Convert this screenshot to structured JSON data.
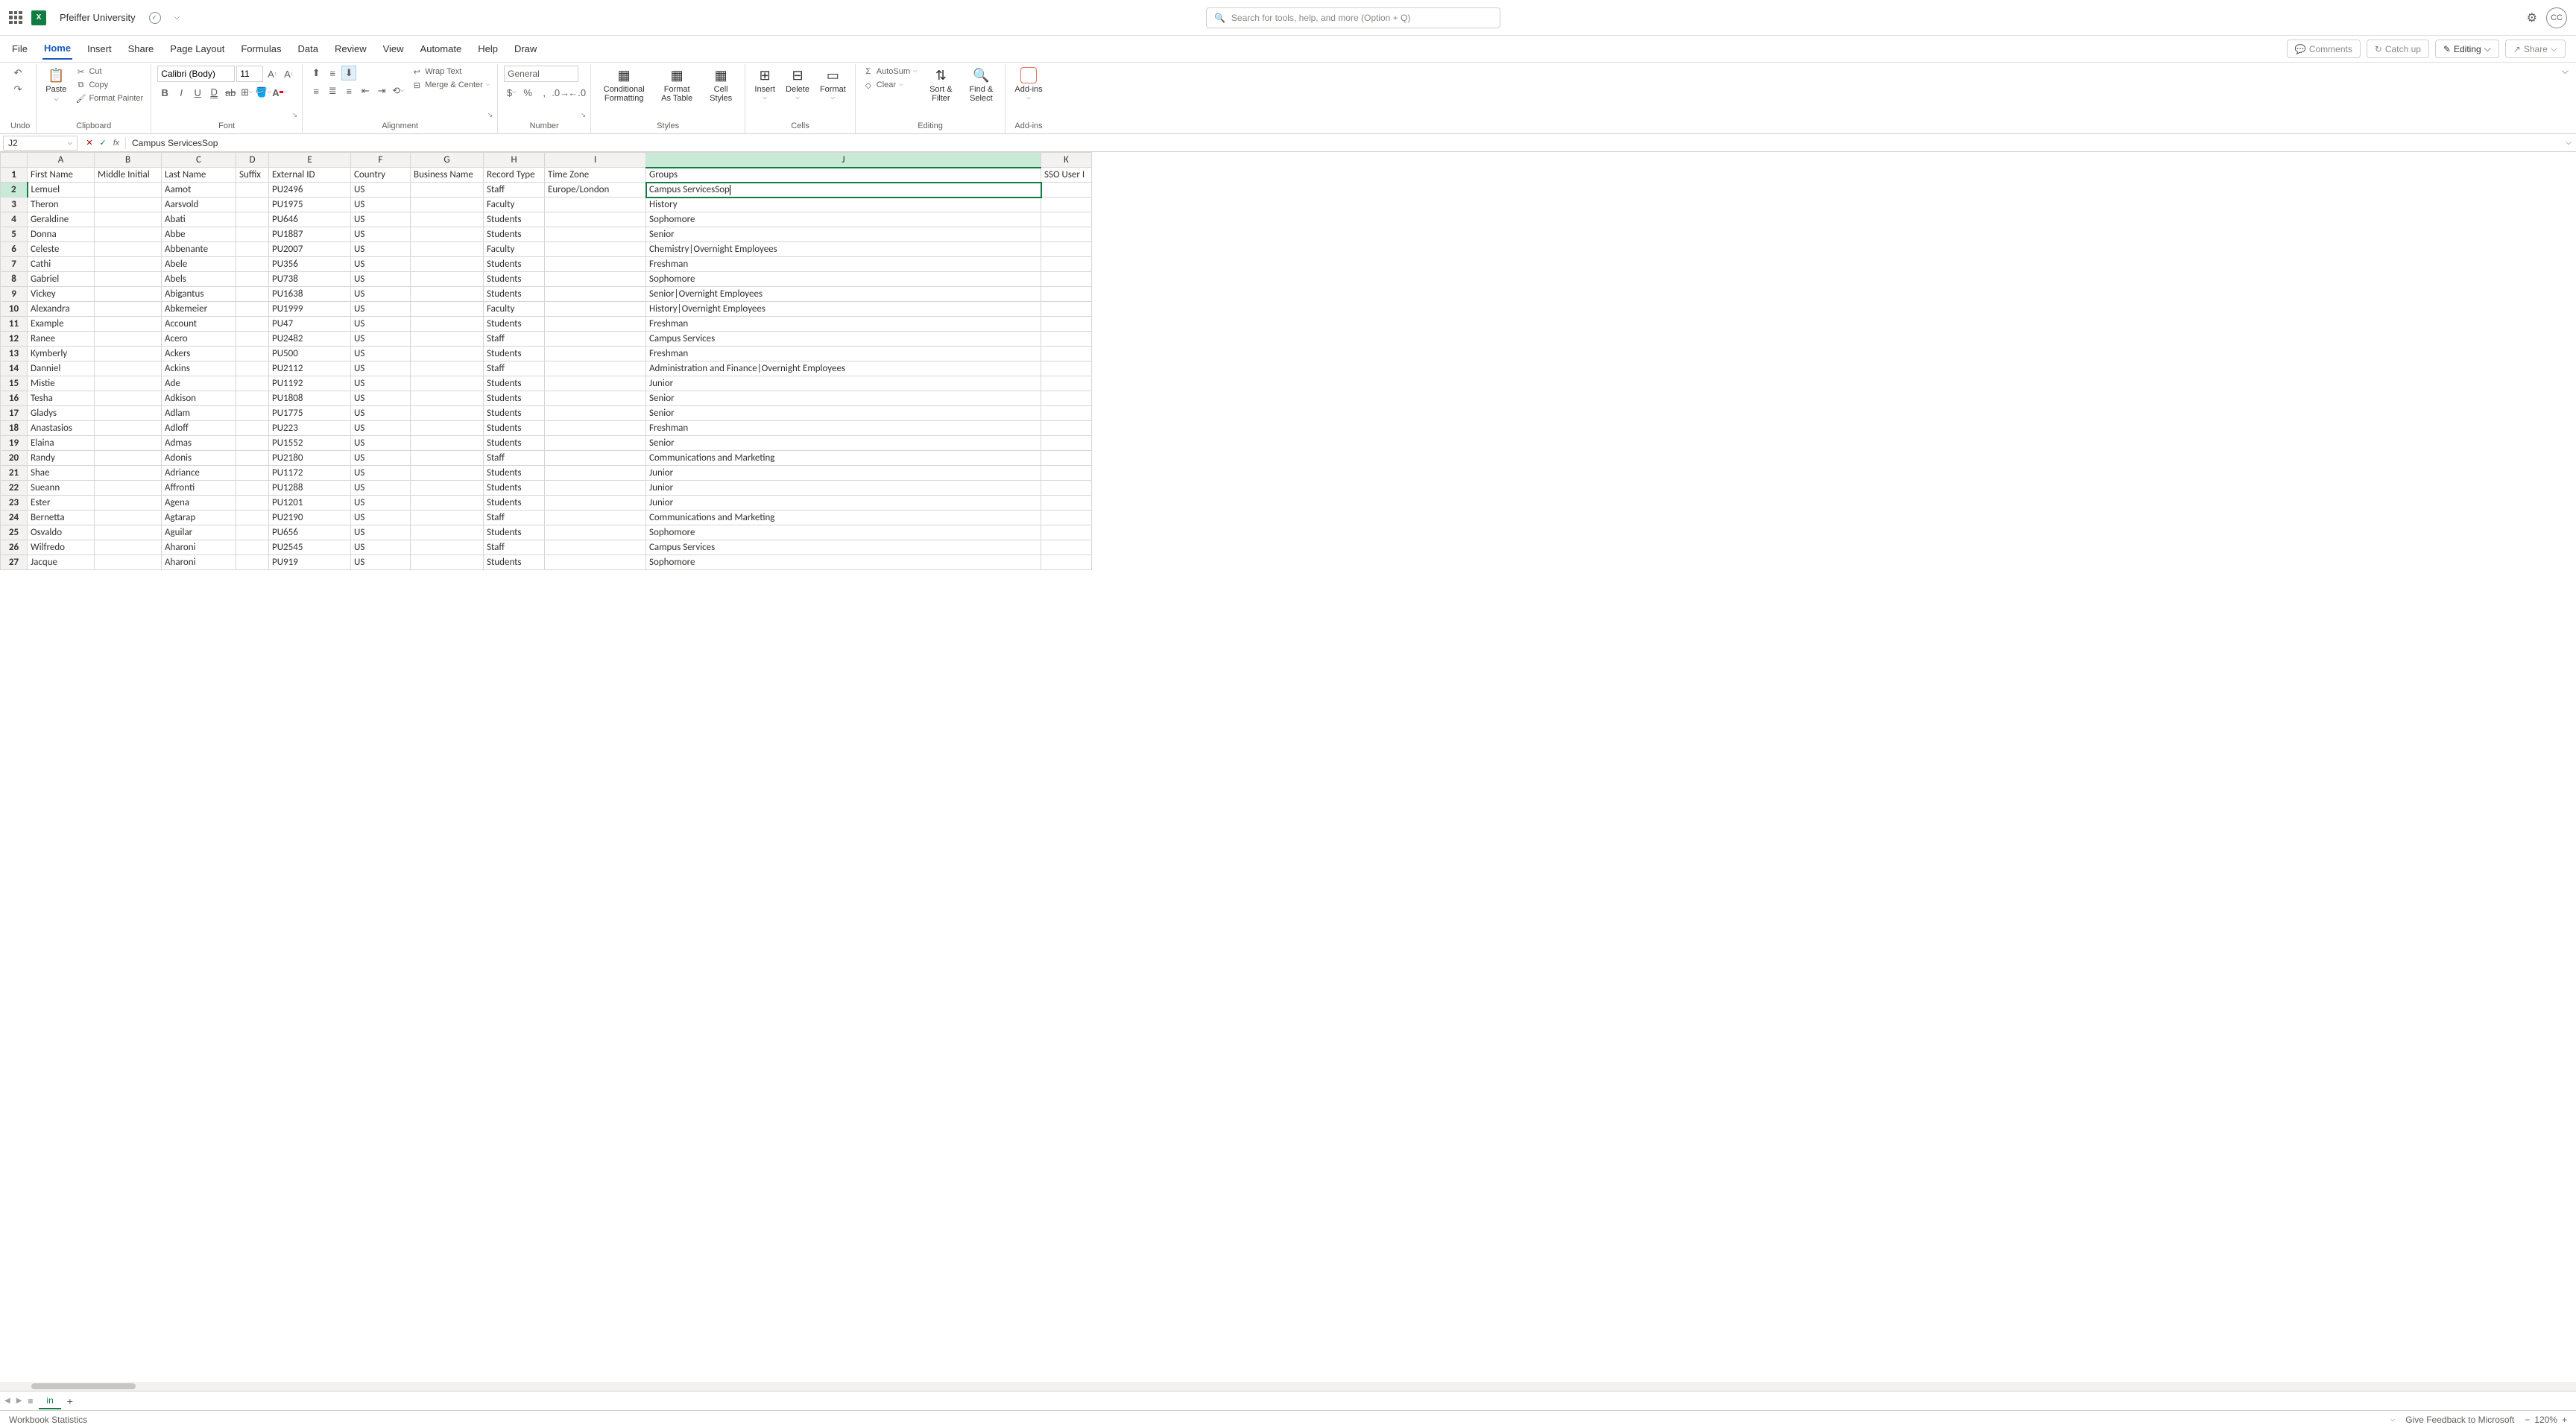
{
  "title": {
    "doc_name": "Pfeiffer University"
  },
  "search": {
    "placeholder": "Search for tools, help, and more (Option + Q)"
  },
  "avatar": "CC",
  "tabs": {
    "items": [
      "File",
      "Home",
      "Insert",
      "Share",
      "Page Layout",
      "Formulas",
      "Data",
      "Review",
      "View",
      "Automate",
      "Help",
      "Draw"
    ],
    "active": "Home",
    "right": {
      "comments": "Comments",
      "catchup": "Catch up",
      "editing": "Editing",
      "share": "Share"
    }
  },
  "ribbon": {
    "undo": "Undo",
    "clipboard": {
      "paste": "Paste",
      "cut": "Cut",
      "copy": "Copy",
      "painter": "Format Painter",
      "label": "Clipboard"
    },
    "font": {
      "name": "Calibri (Body)",
      "size": "11",
      "label": "Font"
    },
    "alignment": {
      "wrap": "Wrap Text",
      "merge": "Merge & Center",
      "label": "Alignment"
    },
    "number": {
      "format": "General",
      "label": "Number"
    },
    "styles": {
      "cond": "Conditional Formatting",
      "table": "Format As Table",
      "cell": "Cell Styles",
      "label": "Styles"
    },
    "cells": {
      "insert": "Insert",
      "delete": "Delete",
      "format": "Format",
      "label": "Cells"
    },
    "editing": {
      "autosum": "AutoSum",
      "clear": "Clear",
      "sort": "Sort & Filter",
      "find": "Find & Select",
      "label": "Editing"
    },
    "addins": {
      "label": "Add-ins",
      "btn": "Add-ins"
    }
  },
  "formula_bar": {
    "cell_ref": "J2",
    "formula": "Campus ServicesSop"
  },
  "columns": [
    "A",
    "B",
    "C",
    "D",
    "E",
    "F",
    "G",
    "H",
    "I",
    "J",
    "K"
  ],
  "headers": [
    "First Name",
    "Middle Initial",
    "Last Name",
    "Suffix",
    "External ID",
    "Country",
    "Business Name",
    "Record Type",
    "Time Zone",
    "Groups",
    "SSO User I"
  ],
  "active_cell": {
    "row": 2,
    "col": "J",
    "value": "Campus ServicesSop"
  },
  "rows": [
    {
      "n": 2,
      "A": "Lemuel",
      "C": "Aamot",
      "E": "PU2496",
      "F": "US",
      "H": "Staff",
      "I": "Europe/London",
      "J": "Campus ServicesSop"
    },
    {
      "n": 3,
      "A": "Theron",
      "C": "Aarsvold",
      "E": "PU1975",
      "F": "US",
      "H": "Faculty",
      "J": "History"
    },
    {
      "n": 4,
      "A": "Geraldine",
      "C": "Abati",
      "E": "PU646",
      "F": "US",
      "H": "Students",
      "J": "Sophomore"
    },
    {
      "n": 5,
      "A": "Donna",
      "C": "Abbe",
      "E": "PU1887",
      "F": "US",
      "H": "Students",
      "J": "Senior"
    },
    {
      "n": 6,
      "A": "Celeste",
      "C": "Abbenante",
      "E": "PU2007",
      "F": "US",
      "H": "Faculty",
      "J": "Chemistry|Overnight Employees"
    },
    {
      "n": 7,
      "A": "Cathi",
      "C": "Abele",
      "E": "PU356",
      "F": "US",
      "H": "Students",
      "J": "Freshman"
    },
    {
      "n": 8,
      "A": "Gabriel",
      "C": "Abels",
      "E": "PU738",
      "F": "US",
      "H": "Students",
      "J": "Sophomore"
    },
    {
      "n": 9,
      "A": "Vickey",
      "C": "Abigantus",
      "E": "PU1638",
      "F": "US",
      "H": "Students",
      "J": "Senior|Overnight Employees"
    },
    {
      "n": 10,
      "A": "Alexandra",
      "C": "Abkemeier",
      "E": "PU1999",
      "F": "US",
      "H": "Faculty",
      "J": "History|Overnight Employees"
    },
    {
      "n": 11,
      "A": "Example",
      "C": "Account",
      "E": "PU47",
      "F": "US",
      "H": "Students",
      "J": "Freshman"
    },
    {
      "n": 12,
      "A": "Ranee",
      "C": "Acero",
      "E": "PU2482",
      "F": "US",
      "H": "Staff",
      "J": "Campus Services"
    },
    {
      "n": 13,
      "A": "Kymberly",
      "C": "Ackers",
      "E": "PU500",
      "F": "US",
      "H": "Students",
      "J": "Freshman"
    },
    {
      "n": 14,
      "A": "Danniel",
      "C": "Ackins",
      "E": "PU2112",
      "F": "US",
      "H": "Staff",
      "J": "Administration and Finance|Overnight Employees"
    },
    {
      "n": 15,
      "A": "Mistie",
      "C": "Ade",
      "E": "PU1192",
      "F": "US",
      "H": "Students",
      "J": "Junior"
    },
    {
      "n": 16,
      "A": "Tesha",
      "C": "Adkison",
      "E": "PU1808",
      "F": "US",
      "H": "Students",
      "J": "Senior"
    },
    {
      "n": 17,
      "A": "Gladys",
      "C": "Adlam",
      "E": "PU1775",
      "F": "US",
      "H": "Students",
      "J": "Senior"
    },
    {
      "n": 18,
      "A": "Anastasios",
      "C": "Adloff",
      "E": "PU223",
      "F": "US",
      "H": "Students",
      "J": "Freshman"
    },
    {
      "n": 19,
      "A": "Elaina",
      "C": "Admas",
      "E": "PU1552",
      "F": "US",
      "H": "Students",
      "J": "Senior"
    },
    {
      "n": 20,
      "A": "Randy",
      "C": "Adonis",
      "E": "PU2180",
      "F": "US",
      "H": "Staff",
      "J": "Communications and Marketing"
    },
    {
      "n": 21,
      "A": "Shae",
      "C": "Adriance",
      "E": "PU1172",
      "F": "US",
      "H": "Students",
      "J": "Junior"
    },
    {
      "n": 22,
      "A": "Sueann",
      "C": "Affronti",
      "E": "PU1288",
      "F": "US",
      "H": "Students",
      "J": "Junior"
    },
    {
      "n": 23,
      "A": "Ester",
      "C": "Agena",
      "E": "PU1201",
      "F": "US",
      "H": "Students",
      "J": "Junior"
    },
    {
      "n": 24,
      "A": "Bernetta",
      "C": "Agtarap",
      "E": "PU2190",
      "F": "US",
      "H": "Staff",
      "J": "Communications and Marketing"
    },
    {
      "n": 25,
      "A": "Osvaldo",
      "C": "Aguilar",
      "E": "PU656",
      "F": "US",
      "H": "Students",
      "J": "Sophomore"
    },
    {
      "n": 26,
      "A": "Wilfredo",
      "C": "Aharoni",
      "E": "PU2545",
      "F": "US",
      "H": "Staff",
      "J": "Campus Services"
    },
    {
      "n": 27,
      "A": "Jacque",
      "C": "Aharoni",
      "E": "PU919",
      "F": "US",
      "H": "Students",
      "J": "Sophomore"
    }
  ],
  "sheet": {
    "name": "in"
  },
  "status": {
    "left": "Workbook Statistics",
    "feedback": "Give Feedback to Microsoft",
    "zoom": "120%"
  }
}
